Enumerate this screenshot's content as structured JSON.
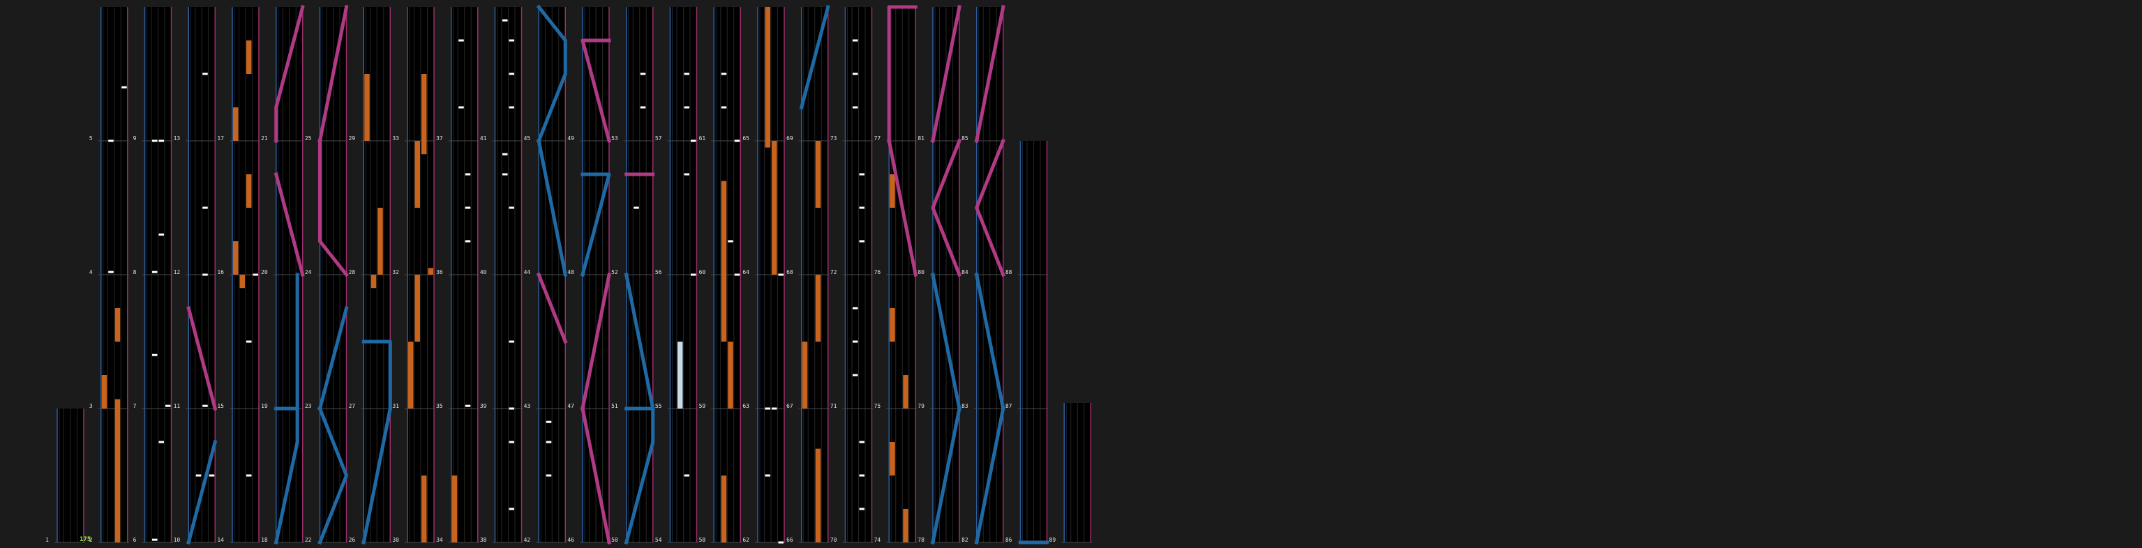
{
  "chart": {
    "bpm_label": "175",
    "colors": {
      "background": "#1b1b1b",
      "lane_bg": "#000000",
      "lane_grid": "#262626",
      "lane_left_border": "#2f5f9a",
      "lane_right_border": "#9a2f6a",
      "measure_line": "#4a4a4a",
      "number_text": "#e0e0e0",
      "bpm_text": "#9be84a",
      "note": "#ffffff",
      "hold": "#c8641e",
      "laser_left": "#1f6aa5",
      "laser_right": "#b03a84",
      "fx_hold": "#c9dbe8"
    },
    "measure_numbers": [
      "1",
      "2",
      "3",
      "4",
      "5",
      "6",
      "7",
      "8",
      "9",
      "10",
      "11",
      "12",
      "13",
      "14",
      "15",
      "16",
      "17",
      "18",
      "19",
      "20",
      "21",
      "22",
      "23",
      "24",
      "25",
      "26",
      "27",
      "28",
      "29",
      "30",
      "31",
      "32",
      "33",
      "34",
      "35",
      "36",
      "37",
      "38",
      "39",
      "40",
      "41",
      "42",
      "43",
      "44",
      "45",
      "46",
      "47",
      "48",
      "49",
      "50",
      "51",
      "52",
      "53",
      "54",
      "55",
      "56",
      "57",
      "58",
      "59",
      "60",
      "61",
      "62",
      "63",
      "64",
      "65",
      "66",
      "67",
      "68",
      "69",
      "70",
      "71",
      "72",
      "73",
      "74",
      "75",
      "76",
      "77",
      "78",
      "79",
      "80",
      "81",
      "82",
      "83",
      "84",
      "85",
      "86",
      "87",
      "88",
      "89"
    ]
  }
}
